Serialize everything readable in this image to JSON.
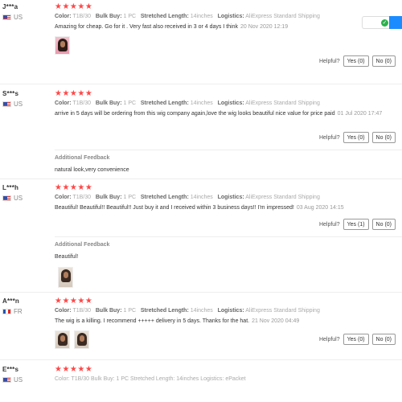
{
  "reviews": [
    {
      "buyer": "J***a",
      "country": "US",
      "stars": "★★★★★",
      "attrs": {
        "color_label": "Color:",
        "color": "T1B/30",
        "bulk_label": "Bulk Buy:",
        "bulk": "1 PC",
        "length_label": "Stretched Length:",
        "length": "14inches",
        "logistics_label": "Logistics:",
        "logistics": "AliExpress Standard Shipping"
      },
      "text": "Amazing for cheap. Go for it . Very fast also received in 3 or 4 days I think",
      "date": "20 Nov 2020 12:19",
      "helpful": "Helpful?",
      "yes": "Yes (0)",
      "no": "No (0)"
    },
    {
      "buyer": "S***s",
      "country": "US",
      "stars": "★★★★★",
      "attrs": {
        "color_label": "Color:",
        "color": "T1B/30",
        "bulk_label": "Bulk Buy:",
        "bulk": "1 PC",
        "length_label": "Stretched Length:",
        "length": "14inches",
        "logistics_label": "Logistics:",
        "logistics": "AliExpress Standard Shipping"
      },
      "text": "arrive in 5 days will be ordering from this wig company again,love the wig looks beautiful nice value for price paid",
      "date": "01 Jul 2020 17:47",
      "helpful": "Helpful?",
      "yes": "Yes (0)",
      "no": "No (0)",
      "additional_label": "Additional Feedback",
      "additional_text": "natural look,very convenience"
    },
    {
      "buyer": "L***h",
      "country": "US",
      "stars": "★★★★★",
      "attrs": {
        "color_label": "Color:",
        "color": "T1B/30",
        "bulk_label": "Bulk Buy:",
        "bulk": "1 PC",
        "length_label": "Stretched Length:",
        "length": "14inches",
        "logistics_label": "Logistics:",
        "logistics": "AliExpress Standard Shipping"
      },
      "text": "Beautiful! Beautiful!! Beautiful!! Just buy it and I received within 3 business days!! I'm impressed!",
      "date": "03 Aug 2020 14:15",
      "helpful": "Helpful?",
      "yes": "Yes (1)",
      "no": "No (0)",
      "additional_label": "Additional Feedback",
      "additional_text": "Beautiful!"
    },
    {
      "buyer": "A***n",
      "country": "FR",
      "stars": "★★★★★",
      "attrs": {
        "color_label": "Color:",
        "color": "T1B/30",
        "bulk_label": "Bulk Buy:",
        "bulk": "1 PC",
        "length_label": "Stretched Length:",
        "length": "14inches",
        "logistics_label": "Logistics:",
        "logistics": "AliExpress Standard Shipping"
      },
      "text": "The wig is a killing. I recommend +++++ delivery in 5 days. Thanks for the hat.",
      "date": "21 Nov 2020 04:49",
      "helpful": "Helpful?",
      "yes": "Yes (0)",
      "no": "No (0)"
    },
    {
      "buyer": "E***s",
      "country": "US",
      "stars": "★★★★★",
      "attrs_text": "Color: T1B/30   Bulk Buy: 1 PC   Stretched Length: 14inches   Logistics: ePacket"
    }
  ],
  "colors": {
    "star": "#ff4747",
    "widget_blue": "#1a8cff",
    "widget_green": "#2bb24c"
  },
  "icons": {
    "flag_us": "us-flag-icon",
    "flag_fr": "fr-flag-icon",
    "check": "check-icon"
  }
}
